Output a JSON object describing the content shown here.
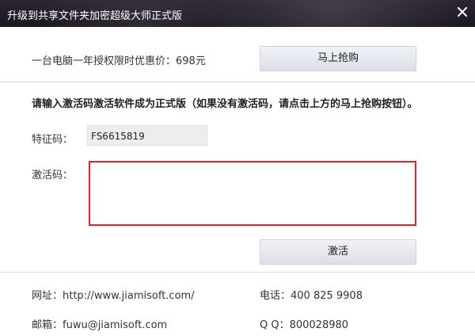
{
  "window": {
    "title": "升级到共享文件夹加密超级大师正式版"
  },
  "purchase": {
    "price_text": "一台电脑一年授权限时优惠价：698元",
    "buy_label": "马上抢购"
  },
  "instruction": "请输入激活码激活软件成为正式版（如果没有激活码，请点击上方的马上抢购按钮）。",
  "form": {
    "feature_label": "特征码：",
    "feature_value": "FS6615819",
    "activation_label": "激活码：",
    "activation_value": "",
    "activate_label": "激活"
  },
  "footer": {
    "website": "网址：http://www.jiamisoft.com/",
    "phone": "电话：400 825 9908",
    "email": "邮箱：fuwu@jiamisoft.com",
    "qq": "Q  Q：800028980"
  },
  "colors": {
    "accent_border": "#d9262a",
    "titlebar": "#1f1b24"
  }
}
